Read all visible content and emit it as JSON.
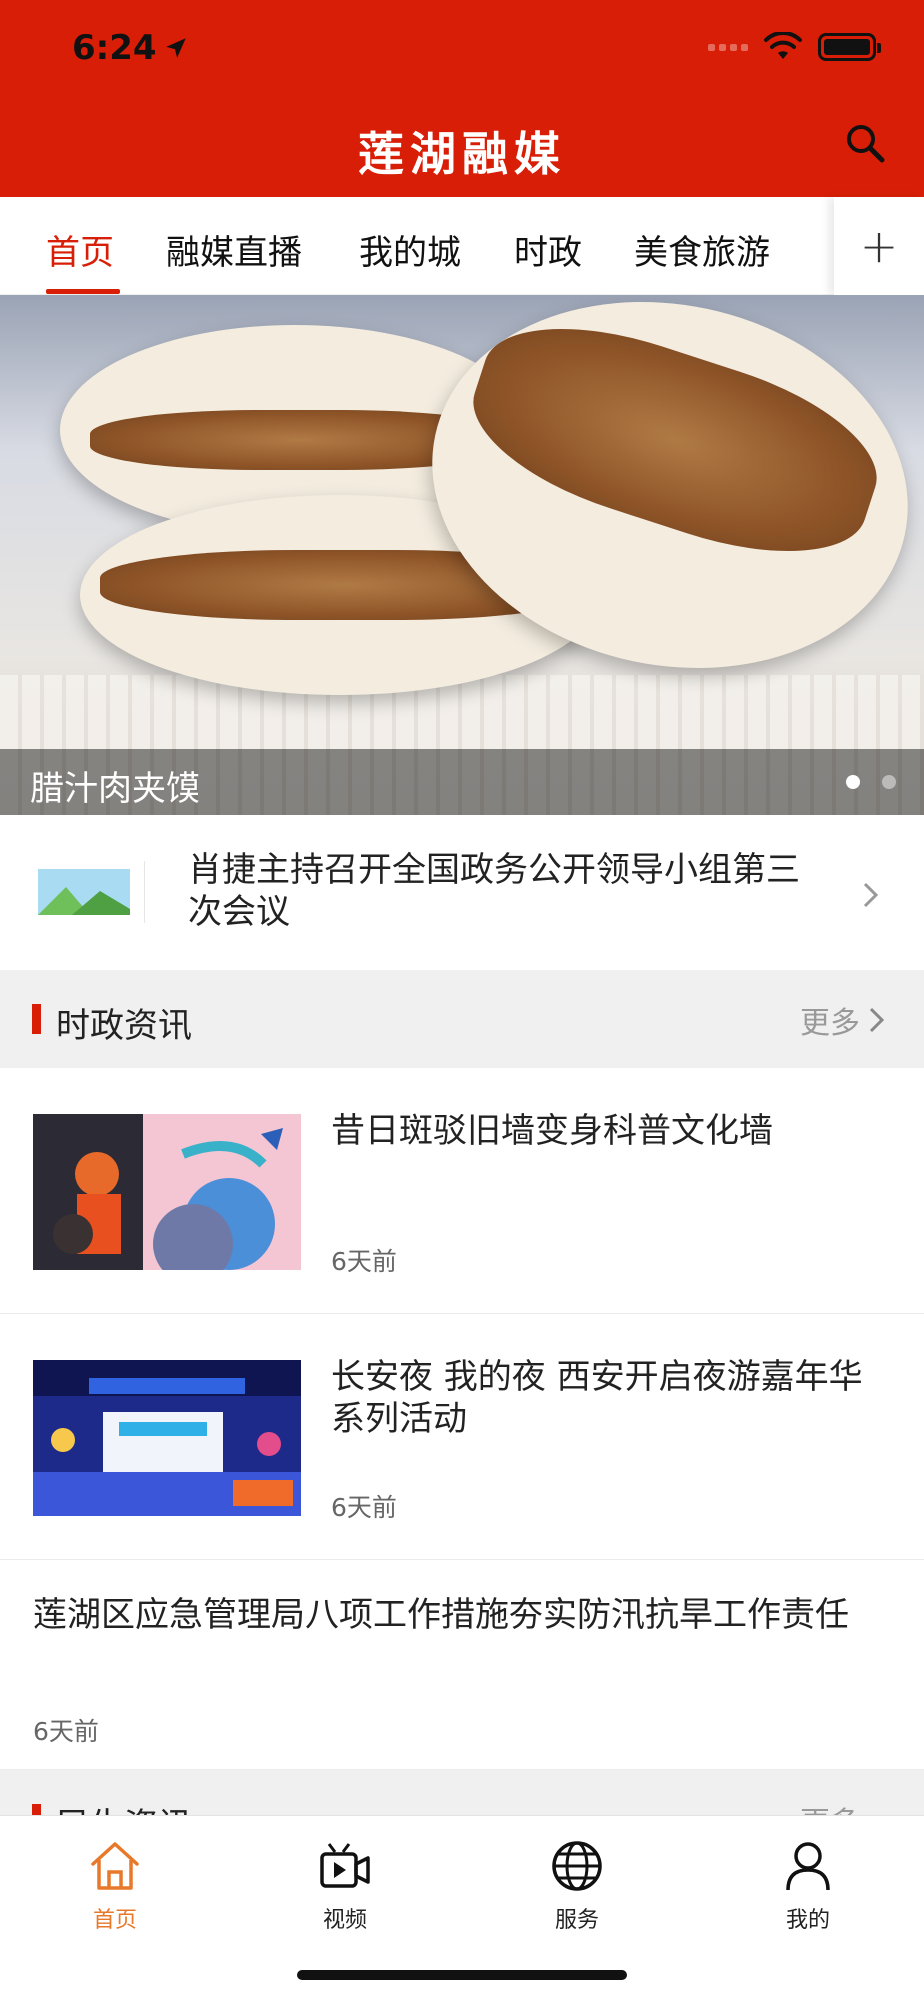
{
  "status_bar": {
    "time": "6:24"
  },
  "header": {
    "title": "莲湖融媒",
    "search_icon": "search-icon"
  },
  "tabs": [
    {
      "label": "首页",
      "active": true
    },
    {
      "label": "融媒直播",
      "active": false
    },
    {
      "label": "我的城",
      "active": false
    },
    {
      "label": "时政",
      "active": false
    },
    {
      "label": "美食旅游",
      "active": false
    }
  ],
  "tab_add": {
    "label": "+"
  },
  "banner": {
    "caption": "腊汁肉夹馍",
    "page": 1,
    "page_count": 2
  },
  "headline": {
    "text": "肖捷主持召开全国政务公开领导小组第三次会议"
  },
  "section_politics": {
    "title": "时政资讯",
    "more": "更多"
  },
  "news": [
    {
      "title": "昔日斑驳旧墙变身科普文化墙",
      "time": "6天前"
    },
    {
      "title": "长安夜 我的夜 西安开启夜游嘉年华系列活动",
      "time": "6天前"
    },
    {
      "title": "莲湖区应急管理局八项工作措施夯实防汛抗旱工作责任",
      "time": "6天前"
    }
  ],
  "section_next": {
    "title": "民生资讯",
    "more": "更多"
  },
  "bottom_nav": [
    {
      "label": "首页",
      "icon": "home-icon",
      "active": true
    },
    {
      "label": "视频",
      "icon": "video-icon",
      "active": false
    },
    {
      "label": "服务",
      "icon": "globe-icon",
      "active": false
    },
    {
      "label": "我的",
      "icon": "user-icon",
      "active": false
    }
  ],
  "colors": {
    "brand_red": "#D81E06",
    "nav_active": "#E8792A"
  }
}
